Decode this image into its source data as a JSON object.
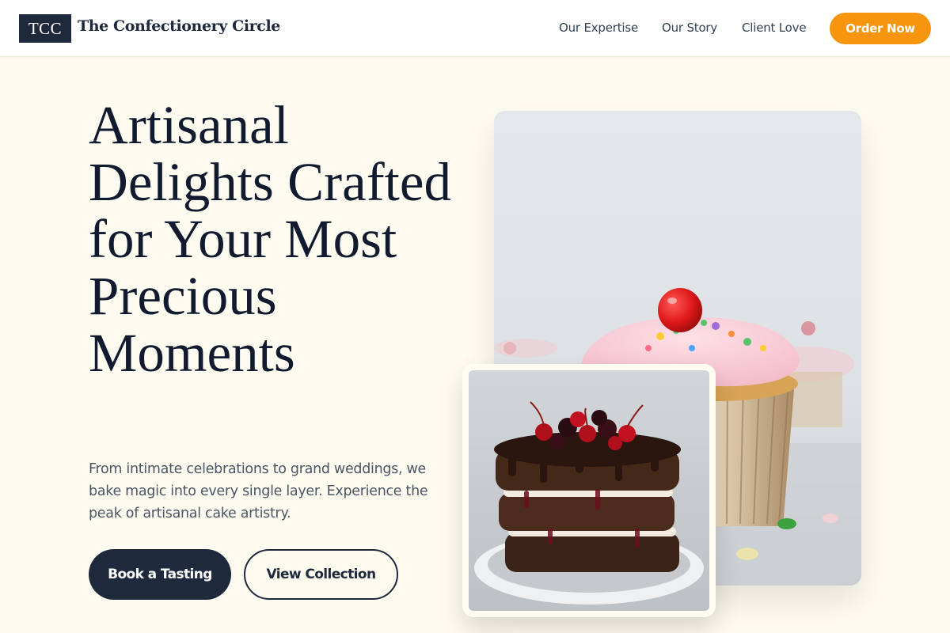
{
  "header": {
    "logo_text": "TCC",
    "brand_name": "The Confectionery Circle",
    "nav": [
      "Our Expertise",
      "Our Story",
      "Client Love"
    ],
    "cta": "Order Now"
  },
  "hero": {
    "title": "Artisanal Delights Crafted for Your Most Precious Moments",
    "subtitle": "From intimate celebrations to grand weddings, we bake magic into every single layer. Experience the peak of artisanal cake artistry.",
    "primary_button": "Book a Tasting",
    "secondary_button": "View Collection"
  },
  "images": {
    "main_alt": "cupcake-photo",
    "card_alt": "layered-chocolate-cherry-cake-photo"
  },
  "colors": {
    "background": "#fefcf1",
    "navy": "#1e293b",
    "accent": "#f7950f"
  }
}
